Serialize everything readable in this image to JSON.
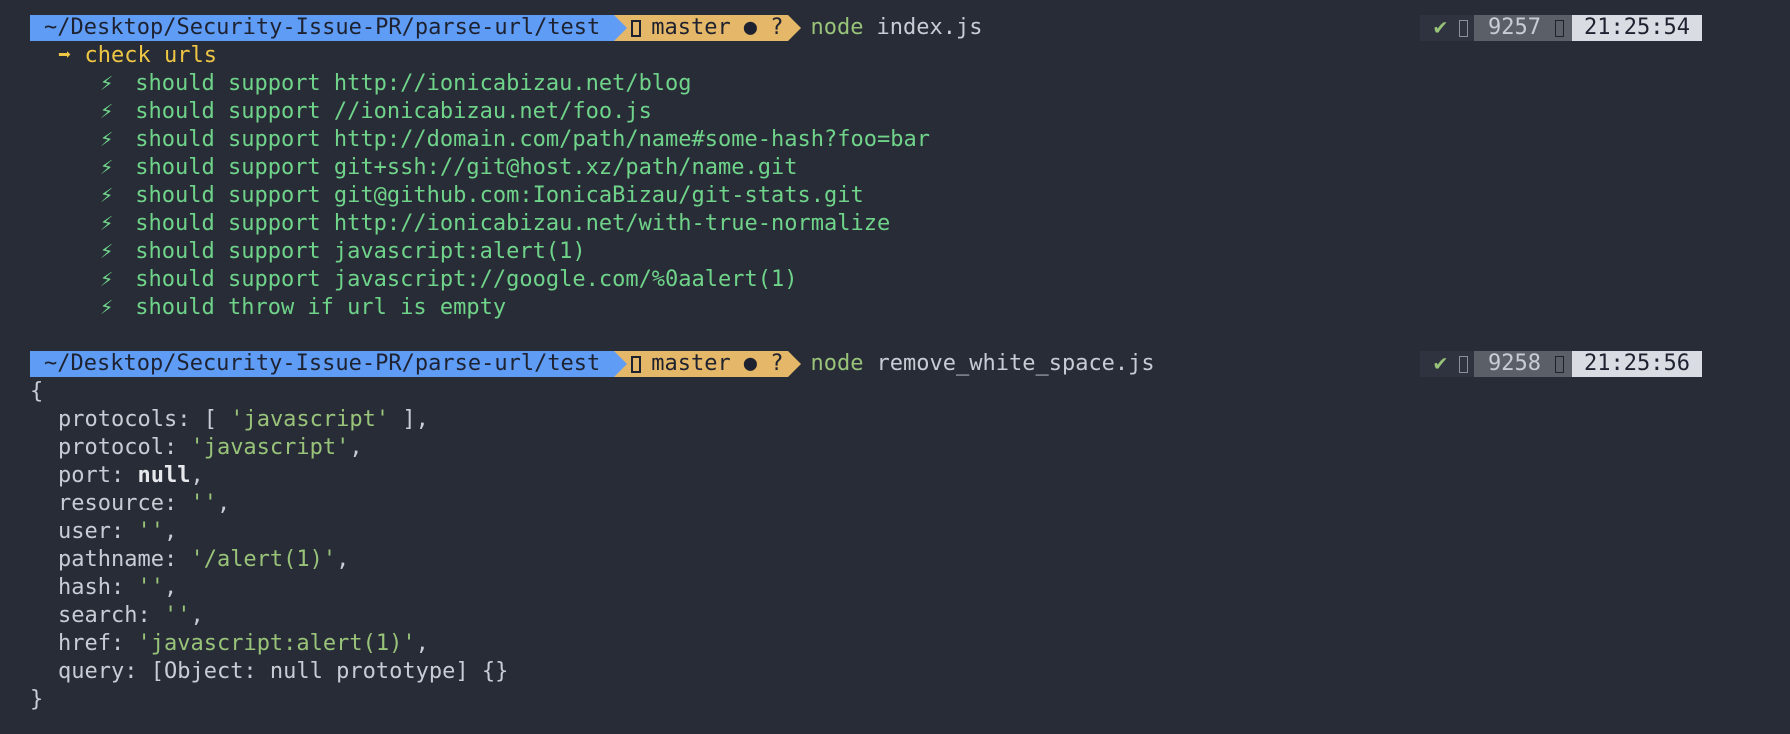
{
  "prompt1": {
    "path": "~/Desktop/Security-Issue-PR/parse-url/test",
    "branch": "master",
    "git_status": "● ?",
    "command": "node",
    "argument": "index.js",
    "check": "✔",
    "pid": "9257",
    "time": "21:25:54"
  },
  "suite": {
    "arrow": "➡",
    "title": "check urls",
    "bolt": "⚡",
    "tests": [
      "should support http://ionicabizau.net/blog",
      "should support //ionicabizau.net/foo.js",
      "should support http://domain.com/path/name#some-hash?foo=bar",
      "should support git+ssh://git@host.xz/path/name.git",
      "should support git@github.com:IonicaBizau/git-stats.git",
      "should support http://ionicabizau.net/with-true-normalize",
      "should support javascript:alert(1)",
      "should support javascript://google.com/%0aalert(1)",
      "should throw if url is empty"
    ]
  },
  "prompt2": {
    "path": "~/Desktop/Security-Issue-PR/parse-url/test",
    "branch": "master",
    "git_status": "● ?",
    "command": "node",
    "argument": "remove_white_space.js",
    "check": "✔",
    "pid": "9258",
    "time": "21:25:56"
  },
  "output": {
    "open_brace": "{",
    "close_brace": "}",
    "protocols_key": "protocols: ",
    "protocols_open": "[ ",
    "protocols_value": "'javascript'",
    "protocols_close": " ],",
    "protocol_key": "protocol: ",
    "protocol_value": "'javascript'",
    "port_key": "port: ",
    "port_value": "null",
    "resource_key": "resource: ",
    "resource_value": "''",
    "user_key": "user: ",
    "user_value": "''",
    "pathname_key": "pathname: ",
    "pathname_value": "'/alert(1)'",
    "hash_key": "hash: ",
    "hash_value": "''",
    "search_key": "search: ",
    "search_value": "''",
    "href_key": "href: ",
    "href_value": "'javascript:alert(1)'",
    "query_key": "query: ",
    "query_value": "[Object: null prototype] {}",
    "comma": ","
  }
}
